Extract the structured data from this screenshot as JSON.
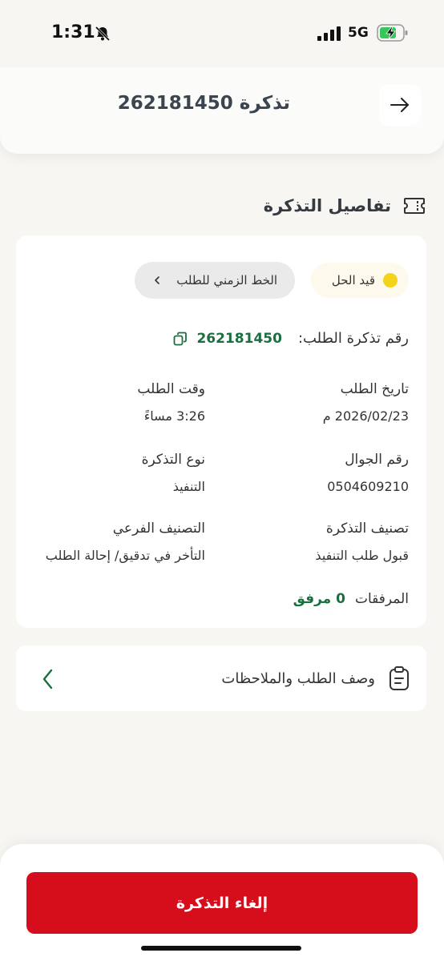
{
  "status_bar": {
    "time": "1:31",
    "network": "5G"
  },
  "header": {
    "title": "تذكرة 262181450"
  },
  "section": {
    "title": "تفاصيل التذكرة"
  },
  "details": {
    "status": "قيد الحل",
    "timeline_label": "الخط الزمني للطلب",
    "ticket_label": "رقم تذكرة الطلب:",
    "ticket_number": "262181450",
    "fields": [
      {
        "label": "تاريخ الطلب",
        "value": "2026/02/23 م"
      },
      {
        "label": "وقت الطلب",
        "value": "3:26 مساءً"
      },
      {
        "label": "رقم الجوال",
        "value": "0504609210"
      },
      {
        "label": "نوع التذكرة",
        "value": "التنفيذ"
      },
      {
        "label": "تصنيف التذكرة",
        "value": "قبول طلب التنفيذ"
      },
      {
        "label": "التصنيف الفرعي",
        "value": "التأخر في تدقيق/ إحالة الطلب"
      }
    ],
    "attachments_label": "المرفقات",
    "attachments_count": "0 مرفق"
  },
  "notes": {
    "label": "وصف الطلب والملاحظات"
  },
  "footer": {
    "cancel_label": "إلغاء التذكرة"
  },
  "colors": {
    "accent_green": "#1a6f40",
    "danger_red": "#d60d1b",
    "status_yellow": "#f5d31a"
  }
}
